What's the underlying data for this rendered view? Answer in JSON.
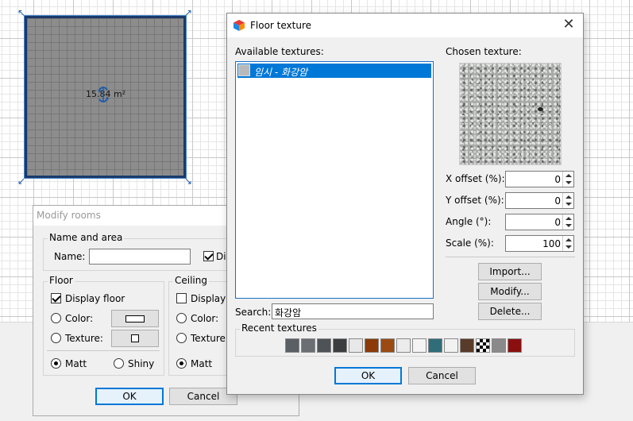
{
  "plan": {
    "room_area": "15.84 m²"
  },
  "modify_rooms": {
    "title": "Modify rooms",
    "name_area_group": "Name and area",
    "name_label": "Name:",
    "name_value": "",
    "area_display_partial": "Dis",
    "floor_group": "Floor",
    "display_floor": "Display floor",
    "color_label": "Color:",
    "texture_label": "Texture:",
    "matt_label": "Matt",
    "shiny_label": "Shiny",
    "ceiling_group": "Ceiling",
    "ceiling_display": "Display",
    "ceiling_color": "Color:",
    "ceiling_texture": "Texture:",
    "ceiling_matt": "Matt",
    "ok_label": "OK",
    "cancel_label": "Cancel"
  },
  "floor_texture": {
    "title": "Floor texture",
    "available_label": "Available textures:",
    "items": [
      {
        "label": "임시 - 화강암"
      }
    ],
    "chosen_label": "Chosen texture:",
    "x_offset_label": "X offset (%):",
    "x_offset": "0",
    "y_offset_label": "Y offset (%):",
    "y_offset": "0",
    "angle_label": "Angle (°):",
    "angle": "0",
    "scale_label": "Scale (%):",
    "scale": "100",
    "import_label": "Import...",
    "modify_label": "Modify...",
    "delete_label": "Delete...",
    "search_label": "Search:",
    "search_value": "화강암",
    "recent_label": "Recent textures",
    "recent_colors": [
      "#5a5f66",
      "#6b6e73",
      "#4e5358",
      "#3c3d3f",
      "#e8e8e8",
      "#8b3a08",
      "#9a4a12",
      "#ececec",
      "#f4f4f4",
      "#2f6e78",
      "#f2f2f2",
      "#5a3a28",
      "checker",
      "#8a8a8a",
      "#8a1010"
    ],
    "ok_label": "OK",
    "cancel_label": "Cancel"
  }
}
